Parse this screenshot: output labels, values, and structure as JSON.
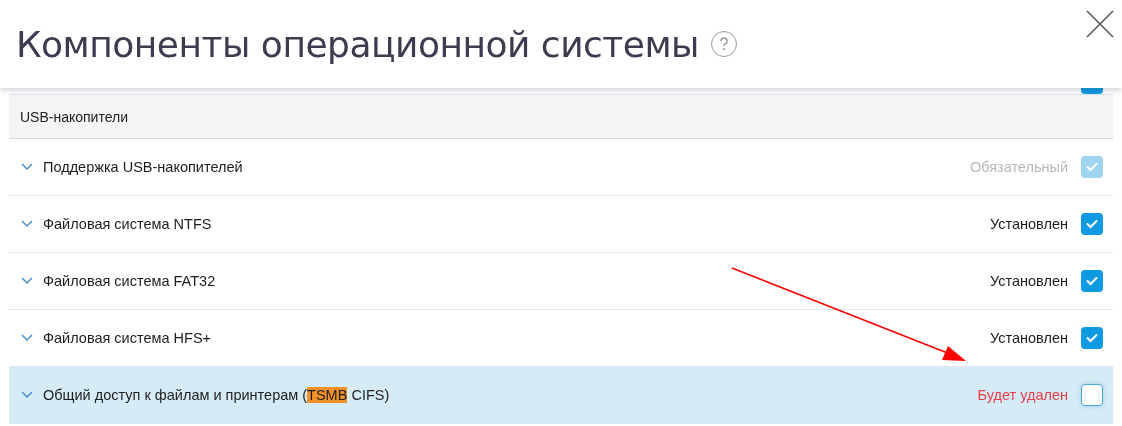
{
  "dialog": {
    "title": "Компоненты операционной системы"
  },
  "partial_row": {
    "checked": true
  },
  "section": {
    "title": "USB-накопители"
  },
  "components": [
    {
      "label": [
        {
          "text": "Поддержка USB-накопителей",
          "highlighted": false
        }
      ],
      "status": "Обязательный",
      "kind": "required",
      "checked": true,
      "selected": false
    },
    {
      "label": [
        {
          "text": "Файловая система NTFS",
          "highlighted": false
        }
      ],
      "status": "Установлен",
      "kind": "installed",
      "checked": true,
      "selected": false
    },
    {
      "label": [
        {
          "text": "Файловая система FAT32",
          "highlighted": false
        }
      ],
      "status": "Установлен",
      "kind": "installed",
      "checked": true,
      "selected": false
    },
    {
      "label": [
        {
          "text": "Файловая система HFS+",
          "highlighted": false
        }
      ],
      "status": "Установлен",
      "kind": "installed",
      "checked": true,
      "selected": false
    },
    {
      "label": [
        {
          "text": "Общий доступ к файлам и принтерам (",
          "highlighted": false
        },
        {
          "text": "TSMB",
          "highlighted": true
        },
        {
          "text": " CIFS)",
          "highlighted": false
        }
      ],
      "status": "Будет удален",
      "kind": "removing",
      "checked": false,
      "selected": true
    }
  ]
}
